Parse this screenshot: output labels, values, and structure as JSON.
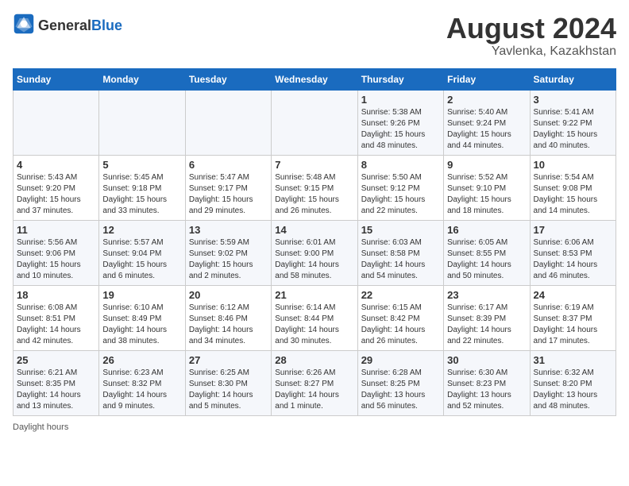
{
  "header": {
    "logo_general": "General",
    "logo_blue": "Blue",
    "month_year": "August 2024",
    "location": "Yavlenka, Kazakhstan"
  },
  "days_of_week": [
    "Sunday",
    "Monday",
    "Tuesday",
    "Wednesday",
    "Thursday",
    "Friday",
    "Saturday"
  ],
  "weeks": [
    [
      {
        "day": "",
        "info": ""
      },
      {
        "day": "",
        "info": ""
      },
      {
        "day": "",
        "info": ""
      },
      {
        "day": "",
        "info": ""
      },
      {
        "day": "1",
        "info": "Sunrise: 5:38 AM\nSunset: 9:26 PM\nDaylight: 15 hours\nand 48 minutes."
      },
      {
        "day": "2",
        "info": "Sunrise: 5:40 AM\nSunset: 9:24 PM\nDaylight: 15 hours\nand 44 minutes."
      },
      {
        "day": "3",
        "info": "Sunrise: 5:41 AM\nSunset: 9:22 PM\nDaylight: 15 hours\nand 40 minutes."
      }
    ],
    [
      {
        "day": "4",
        "info": "Sunrise: 5:43 AM\nSunset: 9:20 PM\nDaylight: 15 hours\nand 37 minutes."
      },
      {
        "day": "5",
        "info": "Sunrise: 5:45 AM\nSunset: 9:18 PM\nDaylight: 15 hours\nand 33 minutes."
      },
      {
        "day": "6",
        "info": "Sunrise: 5:47 AM\nSunset: 9:17 PM\nDaylight: 15 hours\nand 29 minutes."
      },
      {
        "day": "7",
        "info": "Sunrise: 5:48 AM\nSunset: 9:15 PM\nDaylight: 15 hours\nand 26 minutes."
      },
      {
        "day": "8",
        "info": "Sunrise: 5:50 AM\nSunset: 9:12 PM\nDaylight: 15 hours\nand 22 minutes."
      },
      {
        "day": "9",
        "info": "Sunrise: 5:52 AM\nSunset: 9:10 PM\nDaylight: 15 hours\nand 18 minutes."
      },
      {
        "day": "10",
        "info": "Sunrise: 5:54 AM\nSunset: 9:08 PM\nDaylight: 15 hours\nand 14 minutes."
      }
    ],
    [
      {
        "day": "11",
        "info": "Sunrise: 5:56 AM\nSunset: 9:06 PM\nDaylight: 15 hours\nand 10 minutes."
      },
      {
        "day": "12",
        "info": "Sunrise: 5:57 AM\nSunset: 9:04 PM\nDaylight: 15 hours\nand 6 minutes."
      },
      {
        "day": "13",
        "info": "Sunrise: 5:59 AM\nSunset: 9:02 PM\nDaylight: 15 hours\nand 2 minutes."
      },
      {
        "day": "14",
        "info": "Sunrise: 6:01 AM\nSunset: 9:00 PM\nDaylight: 14 hours\nand 58 minutes."
      },
      {
        "day": "15",
        "info": "Sunrise: 6:03 AM\nSunset: 8:58 PM\nDaylight: 14 hours\nand 54 minutes."
      },
      {
        "day": "16",
        "info": "Sunrise: 6:05 AM\nSunset: 8:55 PM\nDaylight: 14 hours\nand 50 minutes."
      },
      {
        "day": "17",
        "info": "Sunrise: 6:06 AM\nSunset: 8:53 PM\nDaylight: 14 hours\nand 46 minutes."
      }
    ],
    [
      {
        "day": "18",
        "info": "Sunrise: 6:08 AM\nSunset: 8:51 PM\nDaylight: 14 hours\nand 42 minutes."
      },
      {
        "day": "19",
        "info": "Sunrise: 6:10 AM\nSunset: 8:49 PM\nDaylight: 14 hours\nand 38 minutes."
      },
      {
        "day": "20",
        "info": "Sunrise: 6:12 AM\nSunset: 8:46 PM\nDaylight: 14 hours\nand 34 minutes."
      },
      {
        "day": "21",
        "info": "Sunrise: 6:14 AM\nSunset: 8:44 PM\nDaylight: 14 hours\nand 30 minutes."
      },
      {
        "day": "22",
        "info": "Sunrise: 6:15 AM\nSunset: 8:42 PM\nDaylight: 14 hours\nand 26 minutes."
      },
      {
        "day": "23",
        "info": "Sunrise: 6:17 AM\nSunset: 8:39 PM\nDaylight: 14 hours\nand 22 minutes."
      },
      {
        "day": "24",
        "info": "Sunrise: 6:19 AM\nSunset: 8:37 PM\nDaylight: 14 hours\nand 17 minutes."
      }
    ],
    [
      {
        "day": "25",
        "info": "Sunrise: 6:21 AM\nSunset: 8:35 PM\nDaylight: 14 hours\nand 13 minutes."
      },
      {
        "day": "26",
        "info": "Sunrise: 6:23 AM\nSunset: 8:32 PM\nDaylight: 14 hours\nand 9 minutes."
      },
      {
        "day": "27",
        "info": "Sunrise: 6:25 AM\nSunset: 8:30 PM\nDaylight: 14 hours\nand 5 minutes."
      },
      {
        "day": "28",
        "info": "Sunrise: 6:26 AM\nSunset: 8:27 PM\nDaylight: 14 hours\nand 1 minute."
      },
      {
        "day": "29",
        "info": "Sunrise: 6:28 AM\nSunset: 8:25 PM\nDaylight: 13 hours\nand 56 minutes."
      },
      {
        "day": "30",
        "info": "Sunrise: 6:30 AM\nSunset: 8:23 PM\nDaylight: 13 hours\nand 52 minutes."
      },
      {
        "day": "31",
        "info": "Sunrise: 6:32 AM\nSunset: 8:20 PM\nDaylight: 13 hours\nand 48 minutes."
      }
    ]
  ],
  "footer": {
    "daylight_hours": "Daylight hours"
  }
}
